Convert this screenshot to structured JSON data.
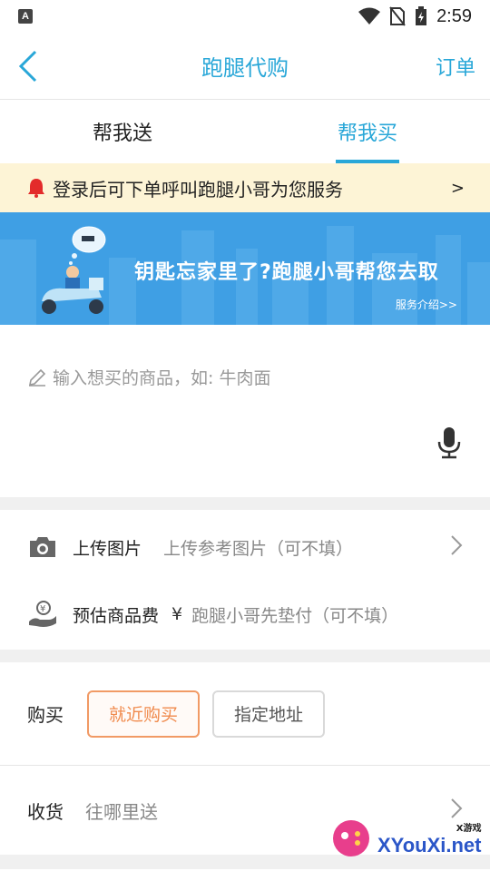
{
  "status_bar": {
    "app_badge": "A",
    "time": "2:59"
  },
  "nav": {
    "title": "跑腿代购",
    "right_label": "订单"
  },
  "tabs": [
    {
      "label": "帮我送",
      "active": false
    },
    {
      "label": "帮我买",
      "active": true
    }
  ],
  "notice": {
    "text": "登录后可下单呼叫跑腿小哥为您服务",
    "arrow": ">"
  },
  "banner": {
    "title": "钥匙忘家里了?跑腿小哥帮您去取",
    "link": "服务介绍>>"
  },
  "goods": {
    "placeholder": "输入想买的商品，如: 牛肉面"
  },
  "upload": {
    "label": "上传图片",
    "hint": "上传参考图片（可不填）"
  },
  "fee": {
    "label": "预估商品费",
    "currency": "¥",
    "hint": "跑腿小哥先垫付（可不填）"
  },
  "buy": {
    "label": "购买",
    "options": [
      {
        "label": "就近购买",
        "selected": true
      },
      {
        "label": "指定地址",
        "selected": false
      }
    ]
  },
  "receive": {
    "label": "收货",
    "placeholder": "往哪里送"
  },
  "watermark": {
    "small": "X游戏",
    "big": "XYouXi.net"
  },
  "colors": {
    "accent": "#29a7d8",
    "banner": "#3f9fe4",
    "notice_bg": "#fdf4d6",
    "selected_orange": "#f08a4c"
  }
}
